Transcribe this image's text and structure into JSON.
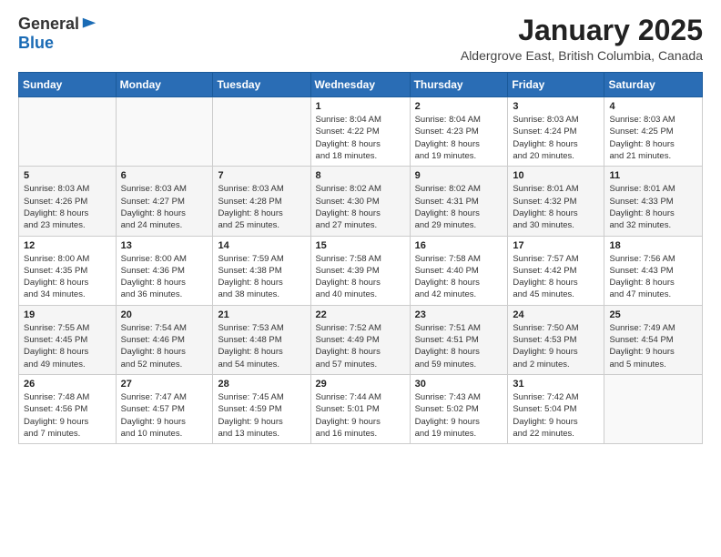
{
  "logo": {
    "general": "General",
    "blue": "Blue"
  },
  "title": "January 2025",
  "subtitle": "Aldergrove East, British Columbia, Canada",
  "days_header": [
    "Sunday",
    "Monday",
    "Tuesday",
    "Wednesday",
    "Thursday",
    "Friday",
    "Saturday"
  ],
  "weeks": [
    [
      {
        "day": "",
        "info": ""
      },
      {
        "day": "",
        "info": ""
      },
      {
        "day": "",
        "info": ""
      },
      {
        "day": "1",
        "info": "Sunrise: 8:04 AM\nSunset: 4:22 PM\nDaylight: 8 hours\nand 18 minutes."
      },
      {
        "day": "2",
        "info": "Sunrise: 8:04 AM\nSunset: 4:23 PM\nDaylight: 8 hours\nand 19 minutes."
      },
      {
        "day": "3",
        "info": "Sunrise: 8:03 AM\nSunset: 4:24 PM\nDaylight: 8 hours\nand 20 minutes."
      },
      {
        "day": "4",
        "info": "Sunrise: 8:03 AM\nSunset: 4:25 PM\nDaylight: 8 hours\nand 21 minutes."
      }
    ],
    [
      {
        "day": "5",
        "info": "Sunrise: 8:03 AM\nSunset: 4:26 PM\nDaylight: 8 hours\nand 23 minutes."
      },
      {
        "day": "6",
        "info": "Sunrise: 8:03 AM\nSunset: 4:27 PM\nDaylight: 8 hours\nand 24 minutes."
      },
      {
        "day": "7",
        "info": "Sunrise: 8:03 AM\nSunset: 4:28 PM\nDaylight: 8 hours\nand 25 minutes."
      },
      {
        "day": "8",
        "info": "Sunrise: 8:02 AM\nSunset: 4:30 PM\nDaylight: 8 hours\nand 27 minutes."
      },
      {
        "day": "9",
        "info": "Sunrise: 8:02 AM\nSunset: 4:31 PM\nDaylight: 8 hours\nand 29 minutes."
      },
      {
        "day": "10",
        "info": "Sunrise: 8:01 AM\nSunset: 4:32 PM\nDaylight: 8 hours\nand 30 minutes."
      },
      {
        "day": "11",
        "info": "Sunrise: 8:01 AM\nSunset: 4:33 PM\nDaylight: 8 hours\nand 32 minutes."
      }
    ],
    [
      {
        "day": "12",
        "info": "Sunrise: 8:00 AM\nSunset: 4:35 PM\nDaylight: 8 hours\nand 34 minutes."
      },
      {
        "day": "13",
        "info": "Sunrise: 8:00 AM\nSunset: 4:36 PM\nDaylight: 8 hours\nand 36 minutes."
      },
      {
        "day": "14",
        "info": "Sunrise: 7:59 AM\nSunset: 4:38 PM\nDaylight: 8 hours\nand 38 minutes."
      },
      {
        "day": "15",
        "info": "Sunrise: 7:58 AM\nSunset: 4:39 PM\nDaylight: 8 hours\nand 40 minutes."
      },
      {
        "day": "16",
        "info": "Sunrise: 7:58 AM\nSunset: 4:40 PM\nDaylight: 8 hours\nand 42 minutes."
      },
      {
        "day": "17",
        "info": "Sunrise: 7:57 AM\nSunset: 4:42 PM\nDaylight: 8 hours\nand 45 minutes."
      },
      {
        "day": "18",
        "info": "Sunrise: 7:56 AM\nSunset: 4:43 PM\nDaylight: 8 hours\nand 47 minutes."
      }
    ],
    [
      {
        "day": "19",
        "info": "Sunrise: 7:55 AM\nSunset: 4:45 PM\nDaylight: 8 hours\nand 49 minutes."
      },
      {
        "day": "20",
        "info": "Sunrise: 7:54 AM\nSunset: 4:46 PM\nDaylight: 8 hours\nand 52 minutes."
      },
      {
        "day": "21",
        "info": "Sunrise: 7:53 AM\nSunset: 4:48 PM\nDaylight: 8 hours\nand 54 minutes."
      },
      {
        "day": "22",
        "info": "Sunrise: 7:52 AM\nSunset: 4:49 PM\nDaylight: 8 hours\nand 57 minutes."
      },
      {
        "day": "23",
        "info": "Sunrise: 7:51 AM\nSunset: 4:51 PM\nDaylight: 8 hours\nand 59 minutes."
      },
      {
        "day": "24",
        "info": "Sunrise: 7:50 AM\nSunset: 4:53 PM\nDaylight: 9 hours\nand 2 minutes."
      },
      {
        "day": "25",
        "info": "Sunrise: 7:49 AM\nSunset: 4:54 PM\nDaylight: 9 hours\nand 5 minutes."
      }
    ],
    [
      {
        "day": "26",
        "info": "Sunrise: 7:48 AM\nSunset: 4:56 PM\nDaylight: 9 hours\nand 7 minutes."
      },
      {
        "day": "27",
        "info": "Sunrise: 7:47 AM\nSunset: 4:57 PM\nDaylight: 9 hours\nand 10 minutes."
      },
      {
        "day": "28",
        "info": "Sunrise: 7:45 AM\nSunset: 4:59 PM\nDaylight: 9 hours\nand 13 minutes."
      },
      {
        "day": "29",
        "info": "Sunrise: 7:44 AM\nSunset: 5:01 PM\nDaylight: 9 hours\nand 16 minutes."
      },
      {
        "day": "30",
        "info": "Sunrise: 7:43 AM\nSunset: 5:02 PM\nDaylight: 9 hours\nand 19 minutes."
      },
      {
        "day": "31",
        "info": "Sunrise: 7:42 AM\nSunset: 5:04 PM\nDaylight: 9 hours\nand 22 minutes."
      },
      {
        "day": "",
        "info": ""
      }
    ]
  ]
}
